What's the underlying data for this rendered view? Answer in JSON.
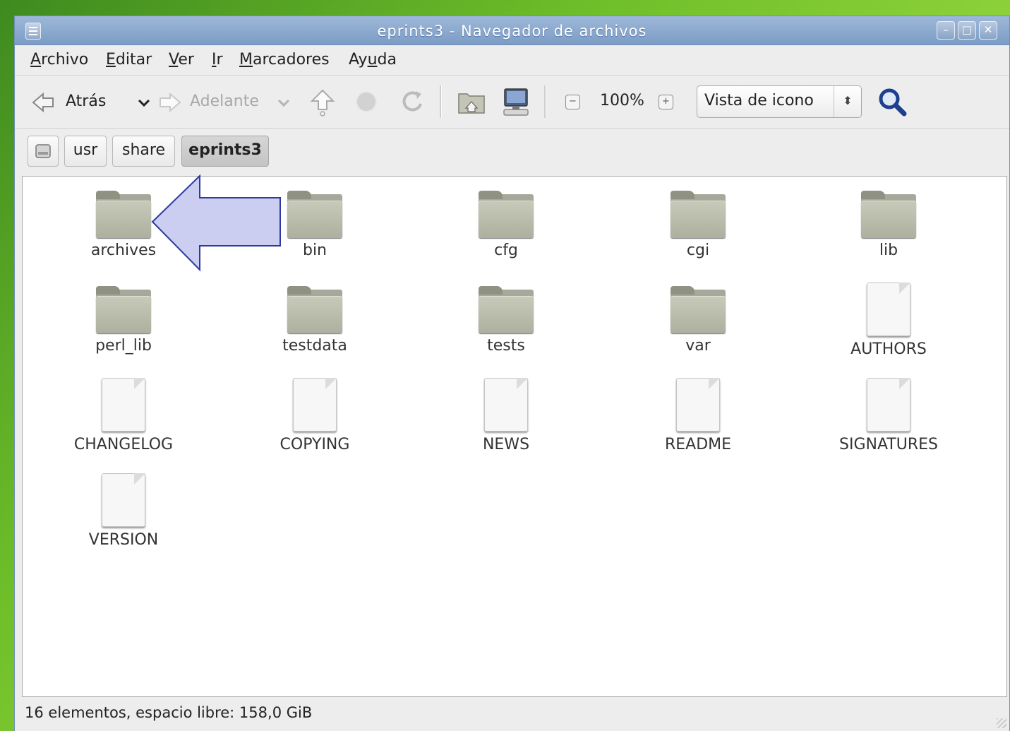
{
  "window": {
    "title": "eprints3 - Navegador de archivos"
  },
  "menubar": {
    "items": [
      {
        "label": "Archivo",
        "mnemonic": "A",
        "rest": "rchivo"
      },
      {
        "label": "Editar",
        "mnemonic": "E",
        "rest": "ditar"
      },
      {
        "label": "Ver",
        "mnemonic": "V",
        "rest": "er"
      },
      {
        "label": "Ir",
        "mnemonic": "I",
        "rest": "r"
      },
      {
        "label": "Marcadores",
        "mnemonic": "M",
        "rest": "arcadores"
      },
      {
        "label": "Ayuda",
        "prefix": "Ay",
        "mnemonic": "u",
        "rest": "da"
      }
    ]
  },
  "toolbar": {
    "back_label": "Atrás",
    "forward_label": "Adelante",
    "zoom_level": "100%",
    "view_mode": "Vista de icono"
  },
  "pathbar": {
    "crumbs": [
      "usr",
      "share",
      "eprints3"
    ],
    "active": "eprints3"
  },
  "items": [
    {
      "name": "archives",
      "type": "folder"
    },
    {
      "name": "bin",
      "type": "folder"
    },
    {
      "name": "cfg",
      "type": "folder"
    },
    {
      "name": "cgi",
      "type": "folder"
    },
    {
      "name": "lib",
      "type": "folder"
    },
    {
      "name": "perl_lib",
      "type": "folder"
    },
    {
      "name": "testdata",
      "type": "folder"
    },
    {
      "name": "tests",
      "type": "folder"
    },
    {
      "name": "var",
      "type": "folder"
    },
    {
      "name": "AUTHORS",
      "type": "file"
    },
    {
      "name": "CHANGELOG",
      "type": "file"
    },
    {
      "name": "COPYING",
      "type": "file"
    },
    {
      "name": "NEWS",
      "type": "file"
    },
    {
      "name": "README",
      "type": "file"
    },
    {
      "name": "SIGNATURES",
      "type": "file"
    },
    {
      "name": "VERSION",
      "type": "file"
    }
  ],
  "statusbar": {
    "text": "16 elementos, espacio libre: 158,0 GiB"
  },
  "colors": {
    "titlebar": "#8aa8d0",
    "arrow_fill": "#c5c9ee",
    "arrow_stroke": "#2b3aa0",
    "desktop": "#6fbf2a"
  }
}
